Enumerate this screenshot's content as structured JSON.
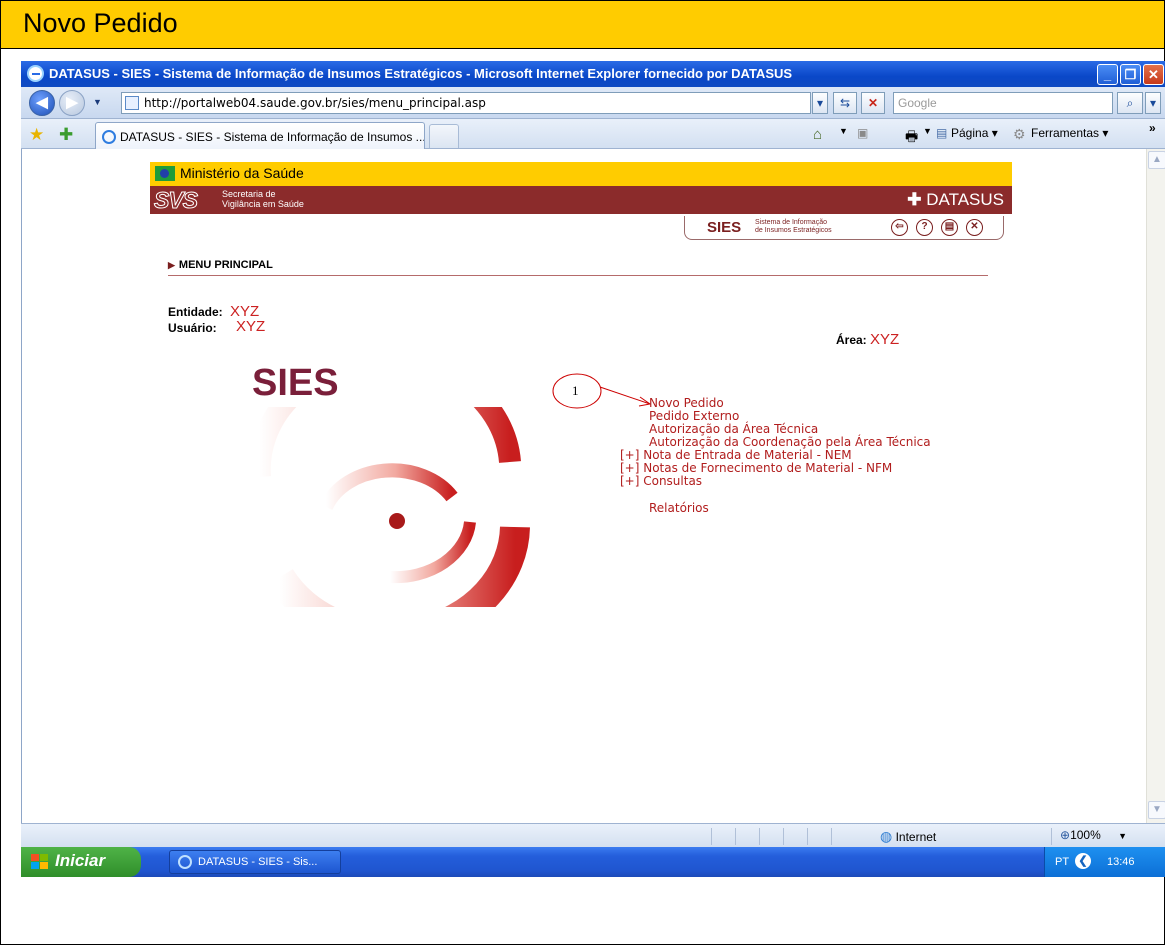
{
  "document": {
    "title": "Novo Pedido"
  },
  "window": {
    "title": "DATASUS - SIES - Sistema de Informação de Insumos Estratégicos - Microsoft Internet Explorer fornecido por DATASUS"
  },
  "address": {
    "url": "http://portalweb04.saude.gov.br/sies/menu_principal.asp",
    "search_placeholder": "Google"
  },
  "tab": {
    "label": "DATASUS - SIES - Sistema de Informação de Insumos ..."
  },
  "commands": {
    "page": "Página",
    "tools": "Ferramentas"
  },
  "header": {
    "ministry": "Ministério da Saúde",
    "svs_logo": "SVS",
    "svs_line1": "Secretaria de",
    "svs_line2": "Vigilância em Saúde",
    "datasus": "DATASUS",
    "sies_short": "SIES",
    "sies_sub_line1": "Sistema de Informação",
    "sies_sub_line2": "de Insumos Estratégicos"
  },
  "page": {
    "heading": "MENU PRINCIPAL",
    "entidade_label": "Entidade:",
    "entidade_value": "XYZ",
    "usuario_label": "Usuário:",
    "usuario_value": "XYZ",
    "area_label": "Área:",
    "area_value": "XYZ",
    "logo_text": "SIES",
    "callout_number": "1"
  },
  "menu": [
    {
      "label": "Novo Pedido"
    },
    {
      "label": "Pedido Externo"
    },
    {
      "label": "Autorização da Área Técnica"
    },
    {
      "label": "Autorização da Coordenação pela Área Técnica"
    },
    {
      "label": "[+] Nota de Entrada de Material - NEM"
    },
    {
      "label": "[+] Notas de Fornecimento de Material - NFM"
    },
    {
      "label": "[+] Consultas"
    },
    {
      "label": "Relatórios"
    }
  ],
  "status": {
    "zone": "Internet",
    "zoom": "100%"
  },
  "taskbar": {
    "start": "Iniciar",
    "task": "DATASUS - SIES - Sis...",
    "language": "PT",
    "clock": "13:46"
  },
  "colors": {
    "accent_yellow": "#ffcc00",
    "brand_maroon": "#8b2b2b",
    "link_red": "#b11d1d",
    "value_red": "#cc2222"
  }
}
